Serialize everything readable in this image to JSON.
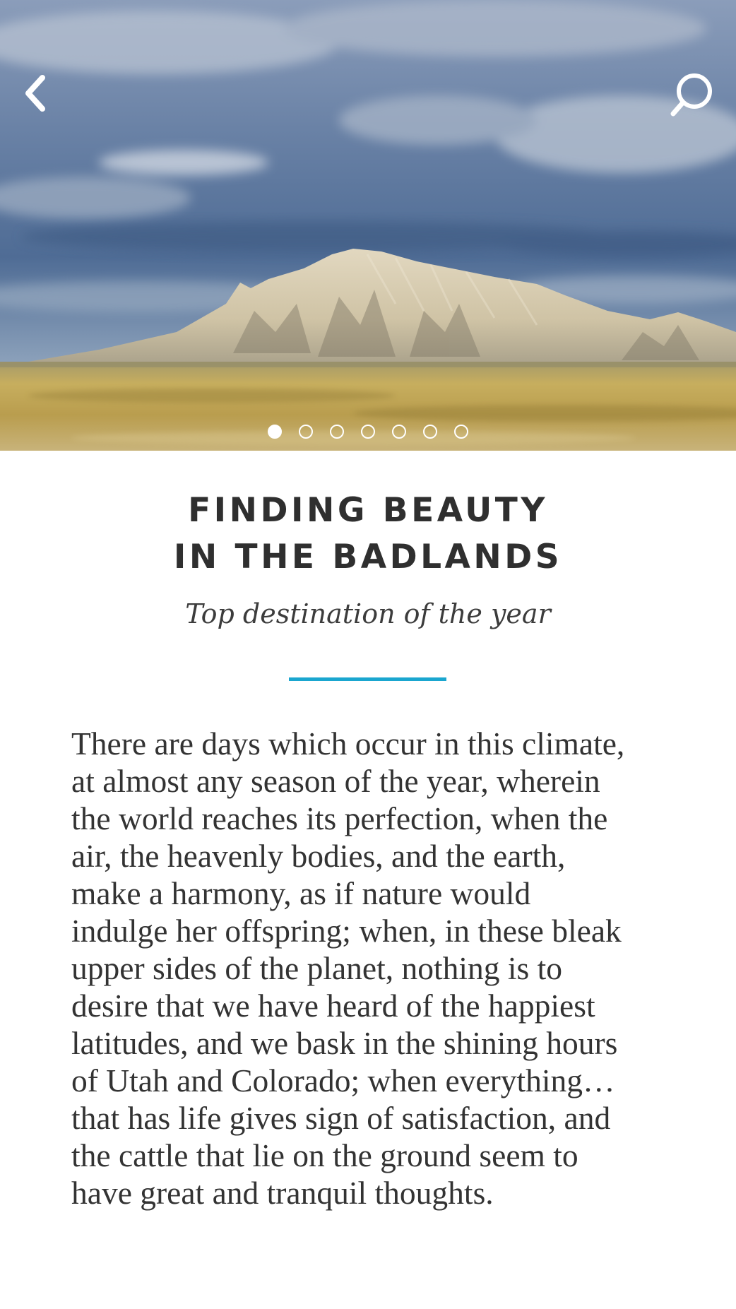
{
  "hero": {
    "back_icon": "chevron-left-icon",
    "search_icon": "search-icon",
    "carousel": {
      "total": 7,
      "active_index": 0
    },
    "colors": {
      "sky": "#5d7596",
      "grass": "#bca55a",
      "rock": "#d9cfb5"
    }
  },
  "article": {
    "title_line1": "FINDING BEAUTY",
    "title_line2": "IN THE BADLANDS",
    "subtitle": "Top destination of the year",
    "accent_color": "#1aa6cf",
    "body": "There are days which occur in this climate,\nat almost any season of the year, wherein\nthe world reaches its perfection, when the\nair, the heavenly bodies, and the earth,\nmake a harmony, as if nature would\nindulge her offspring; when, in these bleak\nupper sides of the planet, nothing is to\ndesire that we have heard of the happiest\nlatitudes, and we bask in the shining hours\nof Utah and Colorado; when everything…\nthat has life gives sign of satisfaction, and\nthe cattle that lie on the ground seem to\nhave great and tranquil thoughts."
  }
}
